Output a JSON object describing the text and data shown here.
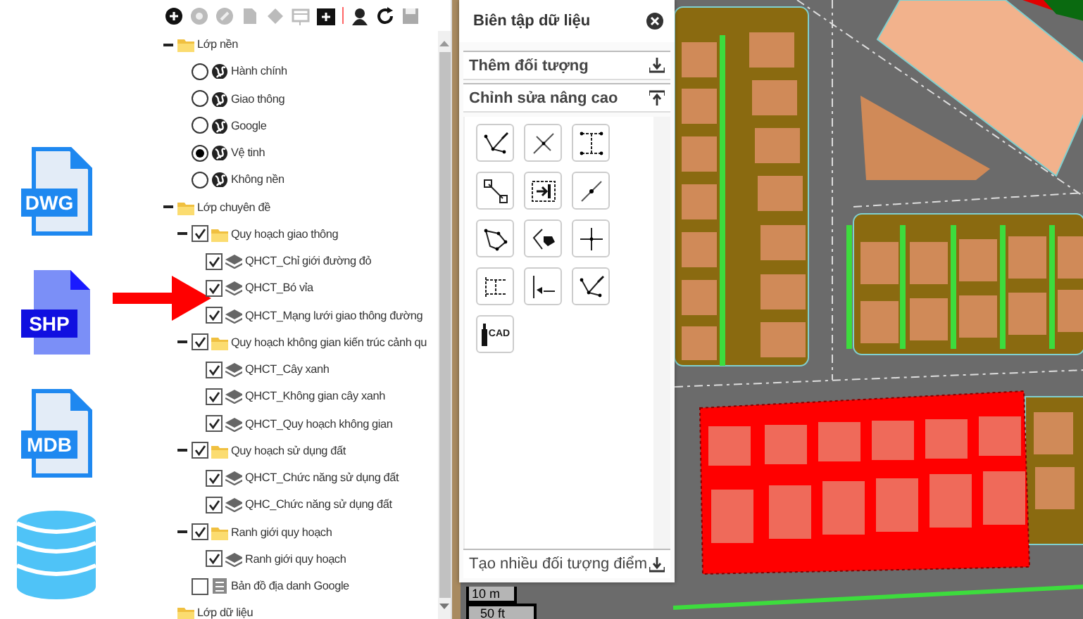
{
  "file_icons": [
    {
      "kind": "file",
      "label": "DWG",
      "color": "#1e88f0"
    },
    {
      "kind": "file",
      "label": "SHP",
      "color": "#7b8ff7"
    },
    {
      "kind": "file",
      "label": "MDB",
      "color": "#1e88f0"
    },
    {
      "kind": "database",
      "color": "#4fc3f7"
    }
  ],
  "layer_tree": [
    {
      "label": "Lớp nền",
      "expanded": true,
      "children": [
        {
          "kind": "radio",
          "label": "Hành chính",
          "selected": false
        },
        {
          "kind": "radio",
          "label": "Giao thông",
          "selected": false
        },
        {
          "kind": "radio",
          "label": "Google",
          "selected": false
        },
        {
          "kind": "radio",
          "label": "Vệ tinh",
          "selected": true
        },
        {
          "kind": "radio",
          "label": "Không nền",
          "selected": false
        }
      ]
    },
    {
      "label": "Lớp chuyên đề",
      "expanded": true,
      "children": [
        {
          "kind": "group",
          "label": "Quy hoạch giao thông",
          "expanded": true,
          "checked": true,
          "children": [
            {
              "kind": "layer",
              "label": "QHCT_Chỉ giới đường đỏ",
              "checked": true
            },
            {
              "kind": "layer",
              "label": "QHCT_Bó vỉa",
              "checked": true
            },
            {
              "kind": "layer",
              "label": "QHCT_Mạng lưới giao thông đường",
              "checked": true
            }
          ]
        },
        {
          "kind": "group",
          "label": "Quy hoạch không gian kiến trúc cảnh qu",
          "expanded": true,
          "checked": true,
          "children": [
            {
              "kind": "layer",
              "label": "QHCT_Cây xanh",
              "checked": true
            },
            {
              "kind": "layer",
              "label": "QHCT_Không gian cây xanh",
              "checked": true
            },
            {
              "kind": "layer",
              "label": "QHCT_Quy hoạch không gian",
              "checked": true
            }
          ]
        },
        {
          "kind": "group",
          "label": "Quy hoạch sử dụng đất",
          "expanded": true,
          "checked": true,
          "children": [
            {
              "kind": "layer",
              "label": "QHCT_Chức năng sử dụng đất",
              "checked": true
            },
            {
              "kind": "layer",
              "label": "QHC_Chức năng sử dụng đất",
              "checked": true
            }
          ]
        },
        {
          "kind": "group",
          "label": "Ranh giới quy hoạch",
          "expanded": true,
          "checked": true,
          "children": [
            {
              "kind": "layer",
              "label": "Ranh giới quy hoạch",
              "checked": true
            }
          ]
        },
        {
          "kind": "page",
          "label": "Bản đồ địa danh Google",
          "checked": false
        }
      ]
    },
    {
      "label": "Lớp dữ liệu",
      "expanded": false
    }
  ],
  "edit_panel": {
    "title": "Biên tập dữ liệu",
    "sections": [
      {
        "label": "Thêm đối tượng",
        "expanded": false
      },
      {
        "label": "Chỉnh sửa nâng cao",
        "expanded": true
      }
    ],
    "tools": [
      {
        "kind": "edit-vertex"
      },
      {
        "kind": "cross-line"
      },
      {
        "kind": "dimension"
      },
      {
        "kind": "snap"
      },
      {
        "kind": "move-in"
      },
      {
        "kind": "split"
      },
      {
        "kind": "polygon"
      },
      {
        "kind": "drag-vertex"
      },
      {
        "kind": "crosshair"
      },
      {
        "kind": "parallel"
      },
      {
        "kind": "extend"
      },
      {
        "kind": "edit-vertex"
      },
      {
        "kind": "cad",
        "label": "CAD"
      }
    ],
    "footer": "Tạo nhiều đối tượng điểm"
  },
  "scale_bar": {
    "metric": "10 m",
    "imperial": "50 ft"
  }
}
